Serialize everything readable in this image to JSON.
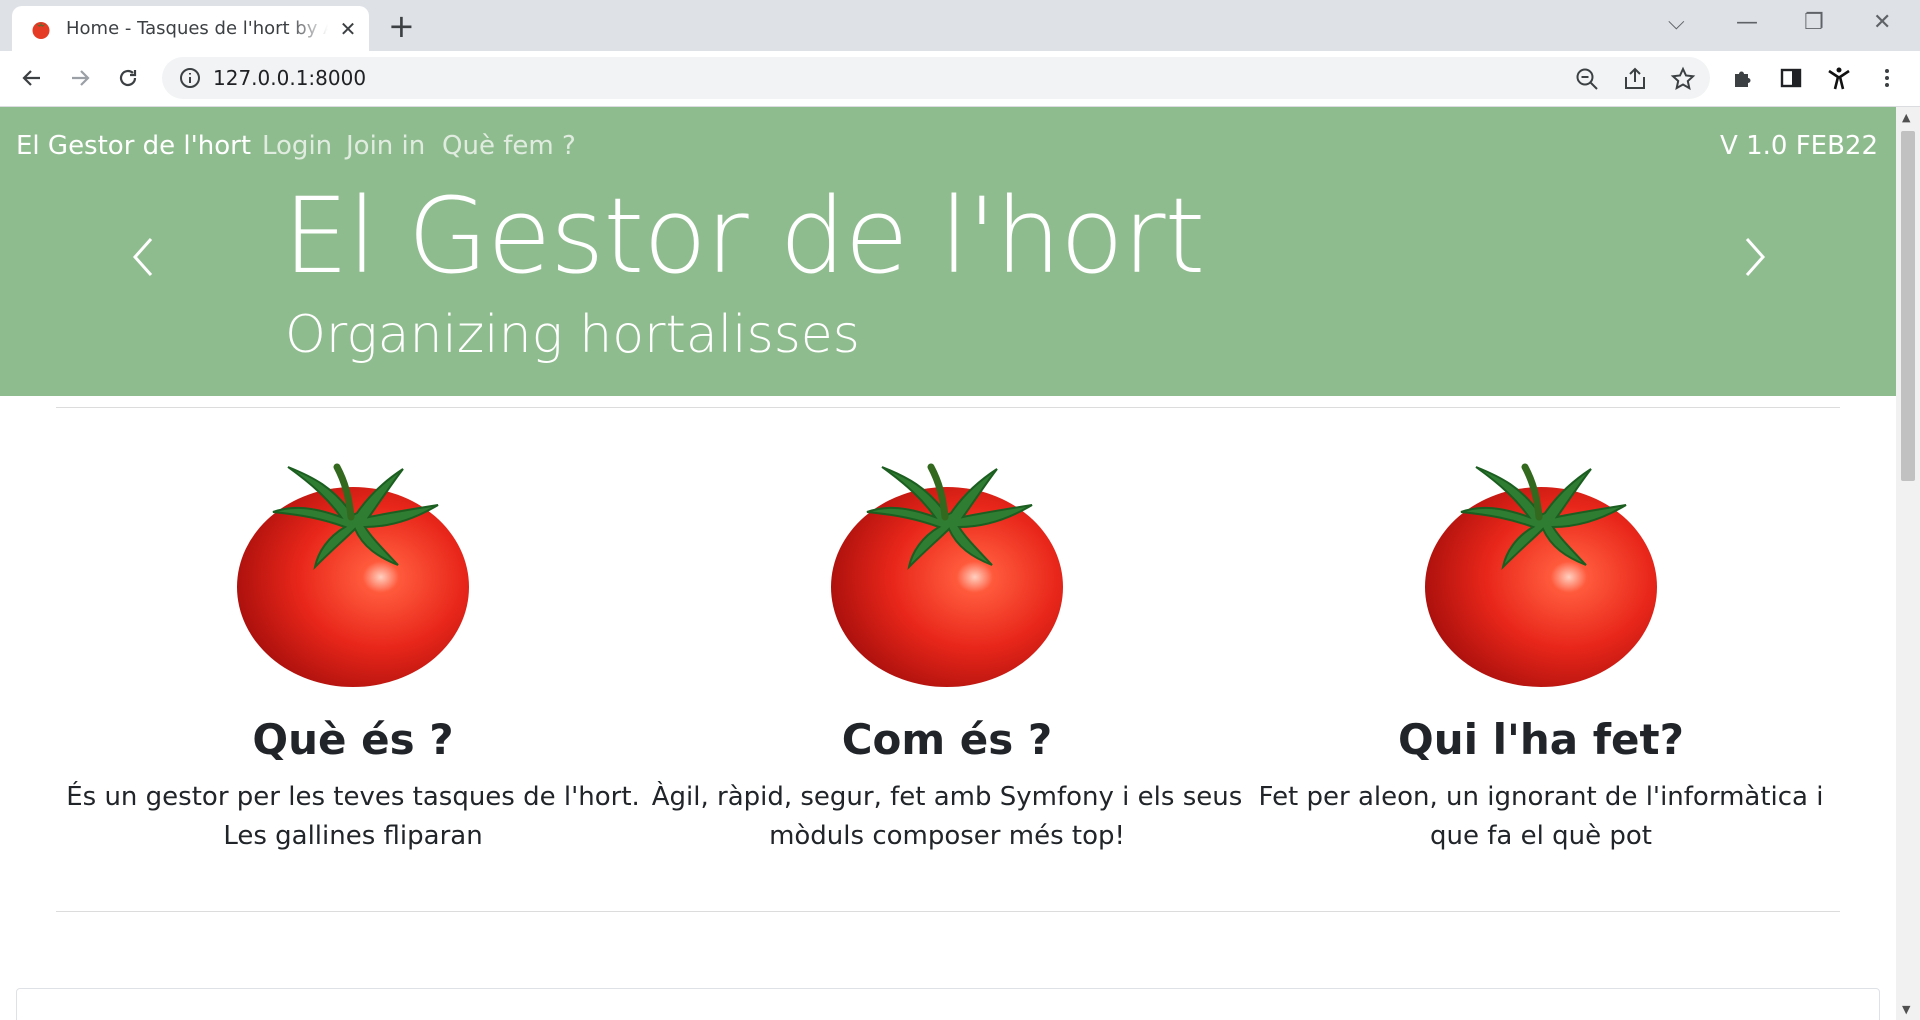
{
  "browser": {
    "tab_title": "Home - Tasques de l'hort by Aleon",
    "tab_close": "✕",
    "new_tab": "+",
    "url": "127.0.0.1:8000",
    "window_controls": {
      "dropdown": "⌵",
      "minimize": "—",
      "restore": "❐",
      "close": "✕"
    }
  },
  "nav": {
    "brand": "El Gestor de l'hort",
    "links": [
      "Login",
      "Join in",
      "Què fem ?"
    ],
    "version": "V 1.0 FEB22"
  },
  "hero": {
    "title": "El Gestor de l'hort",
    "subtitle": "Organizing hortalisses",
    "background": "#8fbc8f"
  },
  "features": [
    {
      "heading": "Què és ?",
      "text": "És un gestor per les teves tasques de l'hort. Les gallines fliparan"
    },
    {
      "heading": "Com és ?",
      "text": "Àgil, ràpid, segur, fet amb Symfony i els seus mòduls composer més top!"
    },
    {
      "heading": "Qui l'ha fet?",
      "text": "Fet per aleon, un ignorant de l'informàtica i que fa el què pot"
    }
  ],
  "icons": {
    "tomato": "tomato-icon",
    "back": "arrow-left-icon",
    "forward": "arrow-right-icon",
    "reload": "reload-icon",
    "info": "info-icon",
    "zoom": "zoom-out-icon",
    "share": "share-icon",
    "bookmark": "star-icon",
    "extensions": "puzzle-icon",
    "sidepanel": "side-panel-icon",
    "profile": "profile-icon",
    "menu": "kebab-menu-icon"
  }
}
